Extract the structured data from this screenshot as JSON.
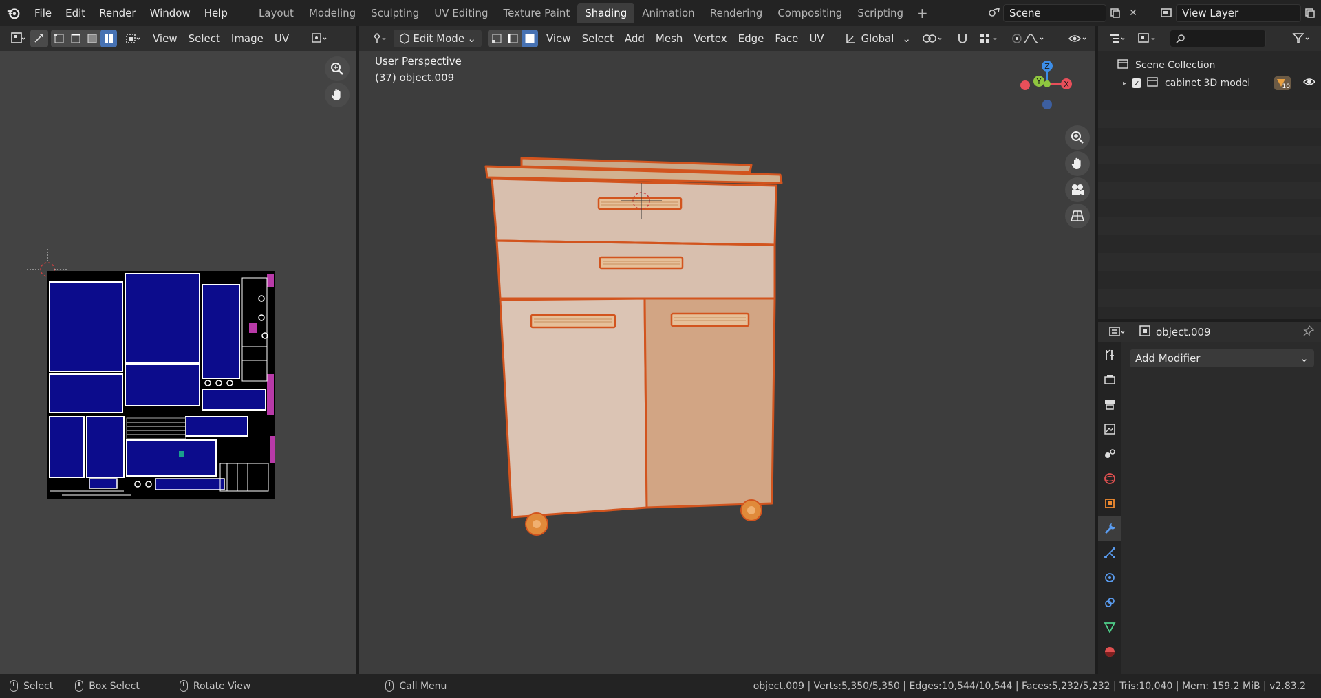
{
  "app": {
    "menus": [
      "File",
      "Edit",
      "Render",
      "Window",
      "Help"
    ],
    "workspaces": [
      "Layout",
      "Modeling",
      "Sculpting",
      "UV Editing",
      "Texture Paint",
      "Shading",
      "Animation",
      "Rendering",
      "Compositing",
      "Scripting"
    ],
    "active_workspace": "Shading",
    "scene": "Scene",
    "view_layer": "View Layer"
  },
  "uv_editor": {
    "menus": [
      "View",
      "Select",
      "Image",
      "UV"
    ]
  },
  "viewport": {
    "mode": "Edit Mode",
    "menus": [
      "View",
      "Select",
      "Add",
      "Mesh",
      "Vertex",
      "Edge",
      "Face",
      "UV"
    ],
    "transform_orientation": "Global",
    "perspective_label": "User Perspective",
    "object_label": "(37) object.009",
    "gizmo_axes": {
      "z": "Z",
      "y": "Y",
      "x": "X"
    },
    "colors": {
      "x": "#e84f5a",
      "y": "#8fc63f",
      "z": "#3d8ee8",
      "selection": "#e06a28"
    }
  },
  "outliner": {
    "root": "Scene Collection",
    "items": [
      {
        "label": "cabinet 3D model",
        "badge": "10"
      }
    ]
  },
  "properties": {
    "object_name": "object.009",
    "add_modifier": "Add Modifier"
  },
  "statusbar": {
    "select": "Select",
    "box_select": "Box Select",
    "rotate_view": "Rotate View",
    "call_menu": "Call Menu",
    "stats": "object.009 | Verts:5,350/5,350 | Edges:10,544/10,544 | Faces:5,232/5,232 | Tris:10,040 | Mem: 159.2 MiB | v2.83.2"
  }
}
